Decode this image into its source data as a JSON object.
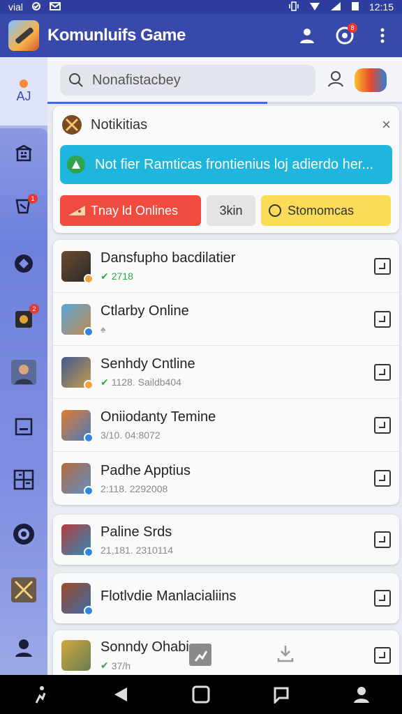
{
  "status_bar": {
    "left_text": "vial",
    "time": "12:15"
  },
  "app": {
    "title": "Komunluifs Game"
  },
  "appbar": {
    "badge_count": "8"
  },
  "rail": {
    "top_label": "AJ",
    "badge_a": "1",
    "badge_b": "2"
  },
  "search": {
    "placeholder": "Nonafistacbey"
  },
  "progress": {
    "fraction": 0.62
  },
  "notification": {
    "title": "Notikitias",
    "close": "×",
    "banner_text": "Not fier Ramticas frontienius loj adierdo her...",
    "btn_primary": "Tnay ld Onlines",
    "btn_secondary": "3kin",
    "btn_tertiary": "Stomomcas"
  },
  "list": [
    {
      "title": "Dansfupho bacdilatier",
      "sub": "2718",
      "sub_icon": "check",
      "colors": [
        "#6b4b2e",
        "#2a2a2a"
      ]
    },
    {
      "title": "Ctlarby Online",
      "sub": "",
      "sub_icon": "trophy",
      "colors": [
        "#5aa6d8",
        "#c28a4e"
      ]
    },
    {
      "title": "Senhdy Cntline",
      "sub": "1128. Saildb404",
      "sub_icon": "check",
      "colors": [
        "#3f5a8a",
        "#c79b4f"
      ]
    },
    {
      "title": "Oniiodanty Temine",
      "sub": "3/10. 04:8072",
      "sub_icon": "",
      "colors": [
        "#e07b2e",
        "#4a7bbf"
      ]
    },
    {
      "title": "Padhe Apptius",
      "sub": "2:118. 2292008",
      "sub_icon": "",
      "colors": [
        "#b36b3a",
        "#5f8fc9"
      ]
    }
  ],
  "single_1": {
    "title": "Paline Srds",
    "sub": "21,181. 2310114",
    "colors": [
      "#b5393a",
      "#2f8fbf"
    ]
  },
  "single_2": {
    "title": "Flotlvdie Manlacialiins",
    "sub": "",
    "colors": [
      "#9b4b2a",
      "#3c6aa8"
    ]
  },
  "single_3": {
    "title": "Sonndy Ohabia",
    "sub": "37/h",
    "colors": [
      "#d1a83a",
      "#6a7d55"
    ]
  }
}
